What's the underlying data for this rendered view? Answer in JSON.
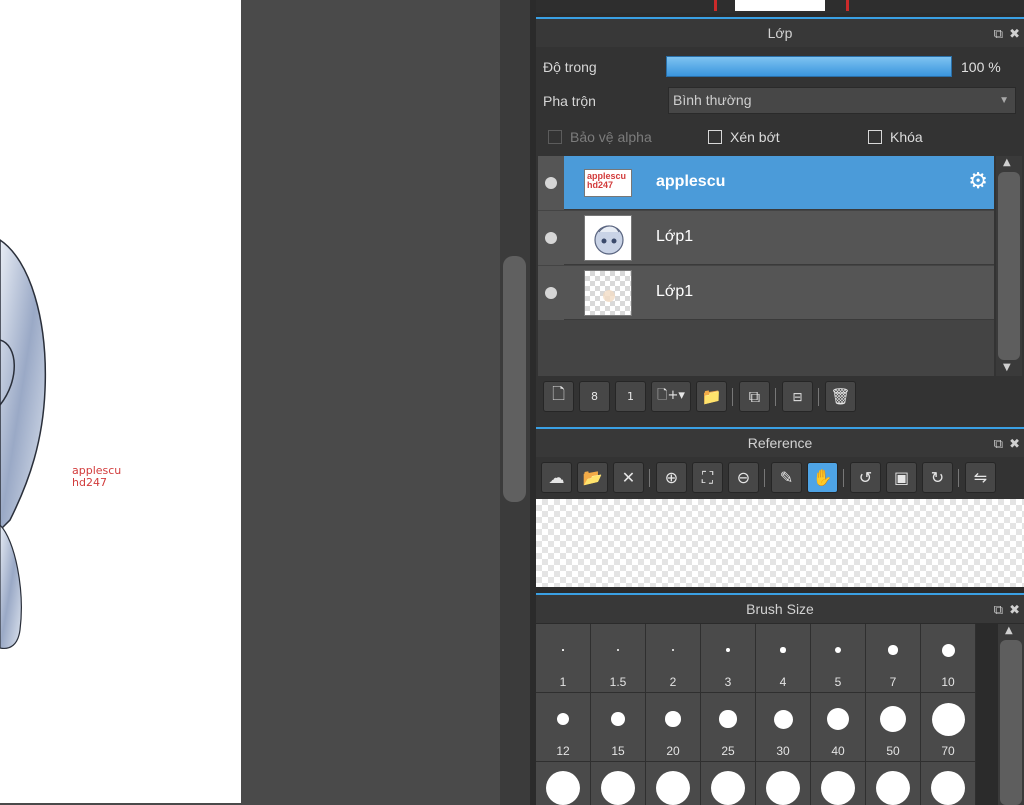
{
  "watermark": {
    "line1": "applescu",
    "line2": "hd247"
  },
  "layer_panel": {
    "title": "Lớp",
    "opacity_label": "Độ trong",
    "opacity_value": "100 %",
    "opacity_fraction": 1.0,
    "blend_label": "Pha trộn",
    "blend_value": "Bình thường",
    "protect_alpha_label": "Bảo vệ alpha",
    "clipping_label": "Xén bớt",
    "lock_label": "Khóa",
    "layers": [
      {
        "name": "applescu",
        "selected": true,
        "thumb_text1": "applescu",
        "thumb_text2": "hd247"
      },
      {
        "name": "Lớp1",
        "selected": false
      },
      {
        "name": "Lớp1",
        "selected": false
      }
    ]
  },
  "reference_panel": {
    "title": "Reference"
  },
  "brush_panel": {
    "title": "Brush Size",
    "sizes": [
      {
        "label": "1",
        "d": 1
      },
      {
        "label": "1.5",
        "d": 1.5
      },
      {
        "label": "2",
        "d": 2
      },
      {
        "label": "3",
        "d": 3
      },
      {
        "label": "4",
        "d": 4
      },
      {
        "label": "5",
        "d": 5
      },
      {
        "label": "7",
        "d": 7
      },
      {
        "label": "10",
        "d": 10
      },
      {
        "label": "12",
        "d": 12
      },
      {
        "label": "15",
        "d": 15
      },
      {
        "label": "20",
        "d": 20
      },
      {
        "label": "25",
        "d": 25
      },
      {
        "label": "30",
        "d": 30
      },
      {
        "label": "40",
        "d": 40
      },
      {
        "label": "50",
        "d": 50
      },
      {
        "label": "70",
        "d": 70
      },
      {
        "label": "",
        "d": 100
      },
      {
        "label": "",
        "d": 100
      },
      {
        "label": "",
        "d": 100
      },
      {
        "label": "",
        "d": 100
      },
      {
        "label": "",
        "d": 100
      },
      {
        "label": "",
        "d": 100
      },
      {
        "label": "",
        "d": 100
      },
      {
        "label": "",
        "d": 100
      }
    ]
  },
  "colors": {
    "accent": "#4b9bd9",
    "panel_bg": "#333333",
    "watermark_red": "#d23b3b"
  }
}
